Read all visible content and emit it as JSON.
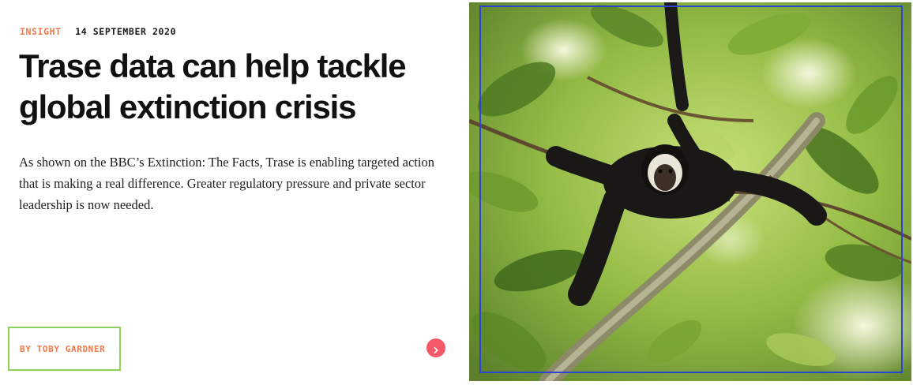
{
  "article": {
    "category": "INSIGHT",
    "date": "14 SEPTEMBER 2020",
    "title": "Trase data can help tackle global extinction crisis",
    "summary": "As shown on the BBC’s Extinction: The Facts, Trase is enabling targeted action that is making a real difference. Greater regulatory pressure and private sector leadership is now needed.",
    "author": "BY TOBY GARDNER"
  },
  "icons": {
    "arrow": "chevron-right-icon"
  },
  "colors": {
    "category": "#f07a4b",
    "author_text": "#f07a4b",
    "author_border": "#8fcf5c",
    "arrow_button": "#f4596a",
    "image_focus_border": "#2a44d6"
  }
}
